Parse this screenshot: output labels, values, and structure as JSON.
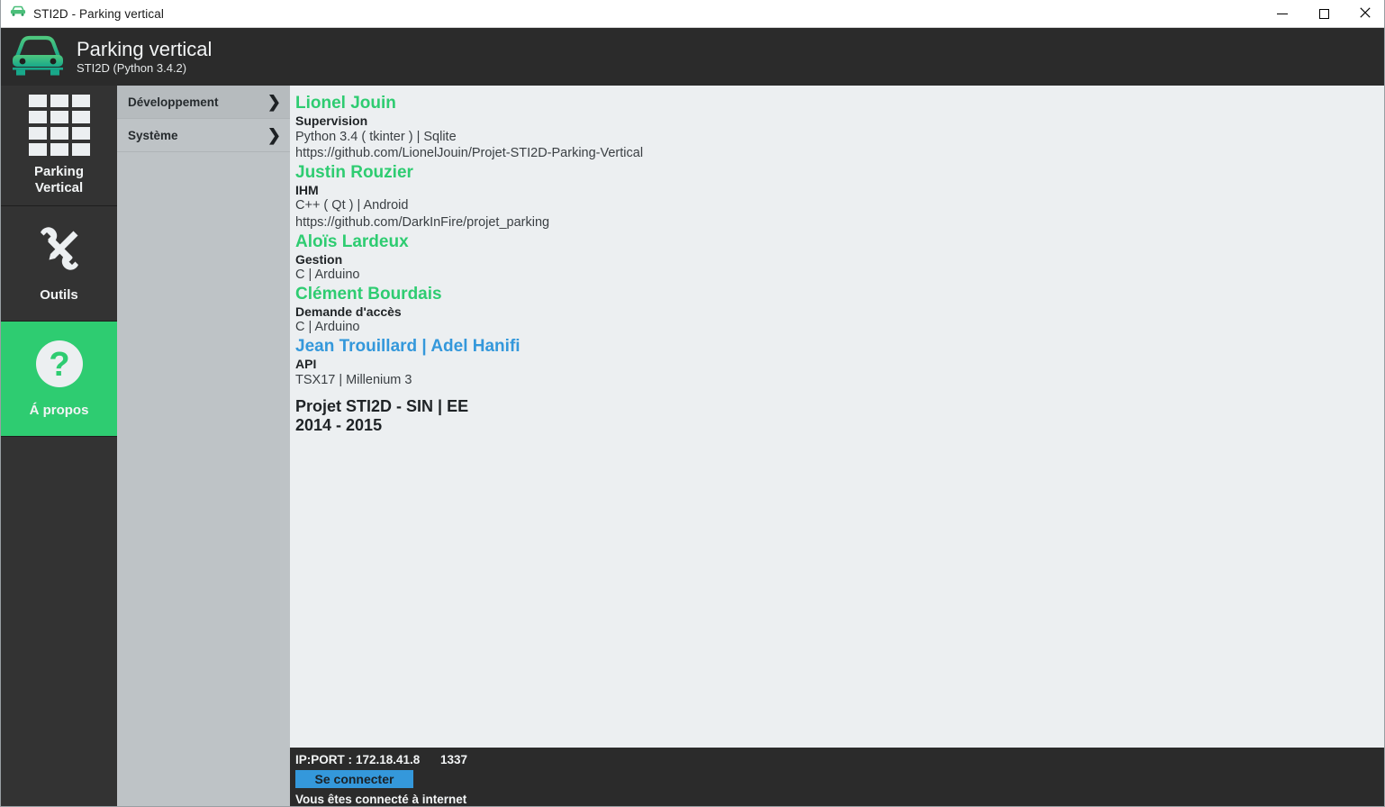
{
  "window": {
    "titlebar_text": "STI2D - Parking vertical",
    "titlebar_icon": "car-icon",
    "minimize_label": "Minimize",
    "maximize_label": "Maximize",
    "close_label": "Close"
  },
  "header": {
    "logo_icon": "car-icon",
    "title": "Parking vertical",
    "subtitle": "STI2D (Python 3.4.2)"
  },
  "sidebar": {
    "items": [
      {
        "label": "Parking\nVertical",
        "label_line1": "Parking",
        "label_line2": "Vertical",
        "icon": "grid-icon",
        "active": false
      },
      {
        "label": "Outils",
        "icon": "tools-icon",
        "active": false
      },
      {
        "label": "Á propos",
        "icon": "question-mark-icon",
        "active": true
      }
    ]
  },
  "menu": {
    "items": [
      {
        "label": "Développement",
        "chevron": "❯",
        "active": true
      },
      {
        "label": "Système",
        "chevron": "❯",
        "active": false
      }
    ]
  },
  "content": {
    "credits": [
      {
        "name": "Lionel Jouin",
        "name_color": "#2ecc71",
        "role": "Supervision",
        "tech": "Python 3.4 ( tkinter ) | Sqlite",
        "link": "https://github.com/LionelJouin/Projet-STI2D-Parking-Vertical"
      },
      {
        "name": "Justin Rouzier",
        "name_color": "#2ecc71",
        "role": "IHM",
        "tech": "C++ ( Qt ) | Android",
        "link": "https://github.com/DarkInFire/projet_parking"
      },
      {
        "name": "Aloïs Lardeux",
        "name_color": "#2ecc71",
        "role": "Gestion",
        "tech": "C | Arduino",
        "link": ""
      },
      {
        "name": "Clément Bourdais",
        "name_color": "#2ecc71",
        "role": "Demande d'accès",
        "tech": "C | Arduino",
        "link": ""
      },
      {
        "name": "Jean Trouillard | Adel Hanifi",
        "name_color": "#3498db",
        "role": "API",
        "tech": "TSX17 | Millenium 3",
        "link": ""
      }
    ],
    "project_line1": "Projet STI2D - SIN | EE",
    "project_line2": "2014 - 2015"
  },
  "statusbar": {
    "ip_label": "IP:PORT :",
    "ip_value": "172.18.41.8",
    "port_value": "1337",
    "connect_label": "Se connecter",
    "network_status": "Vous êtes connecté à internet"
  },
  "colors": {
    "accent_green": "#2ecc71",
    "accent_blue": "#3498db",
    "dark_chrome": "#2b2b2b",
    "sidebar": "#333333",
    "menu_panel": "#bec3c6",
    "content_bg": "#eceff1"
  }
}
